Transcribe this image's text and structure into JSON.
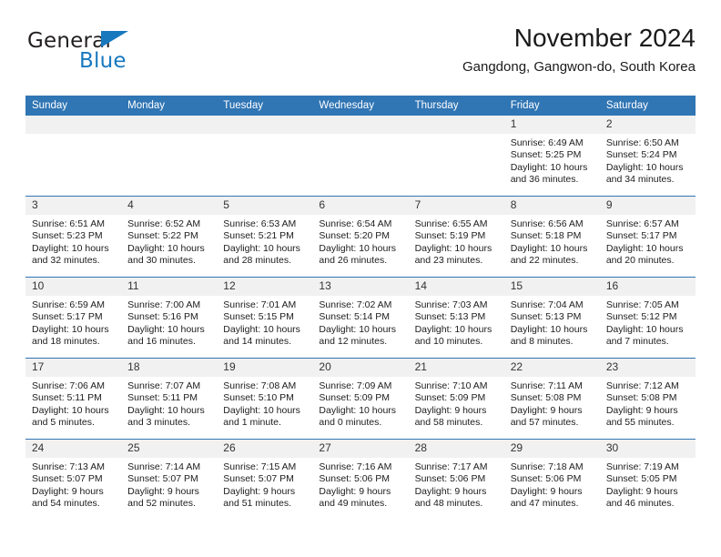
{
  "brand": {
    "name_top": "General",
    "name_bottom": "Blue",
    "triangle_color": "#1878be",
    "text_color": "#231f20"
  },
  "header": {
    "title": "November 2024",
    "subtitle": "Gangdong, Gangwon-do, South Korea"
  },
  "theme": {
    "header_blue": "#3075b4",
    "daynum_bg": "#f1f1f1",
    "text": "#1c1c1c"
  },
  "weekdays": [
    "Sunday",
    "Monday",
    "Tuesday",
    "Wednesday",
    "Thursday",
    "Friday",
    "Saturday"
  ],
  "weeks": [
    [
      {
        "day": "",
        "empty": true
      },
      {
        "day": "",
        "empty": true
      },
      {
        "day": "",
        "empty": true
      },
      {
        "day": "",
        "empty": true
      },
      {
        "day": "",
        "empty": true
      },
      {
        "day": "1",
        "sunrise": "Sunrise: 6:49 AM",
        "sunset": "Sunset: 5:25 PM",
        "daylight": "Daylight: 10 hours and 36 minutes."
      },
      {
        "day": "2",
        "sunrise": "Sunrise: 6:50 AM",
        "sunset": "Sunset: 5:24 PM",
        "daylight": "Daylight: 10 hours and 34 minutes."
      }
    ],
    [
      {
        "day": "3",
        "sunrise": "Sunrise: 6:51 AM",
        "sunset": "Sunset: 5:23 PM",
        "daylight": "Daylight: 10 hours and 32 minutes."
      },
      {
        "day": "4",
        "sunrise": "Sunrise: 6:52 AM",
        "sunset": "Sunset: 5:22 PM",
        "daylight": "Daylight: 10 hours and 30 minutes."
      },
      {
        "day": "5",
        "sunrise": "Sunrise: 6:53 AM",
        "sunset": "Sunset: 5:21 PM",
        "daylight": "Daylight: 10 hours and 28 minutes."
      },
      {
        "day": "6",
        "sunrise": "Sunrise: 6:54 AM",
        "sunset": "Sunset: 5:20 PM",
        "daylight": "Daylight: 10 hours and 26 minutes."
      },
      {
        "day": "7",
        "sunrise": "Sunrise: 6:55 AM",
        "sunset": "Sunset: 5:19 PM",
        "daylight": "Daylight: 10 hours and 23 minutes."
      },
      {
        "day": "8",
        "sunrise": "Sunrise: 6:56 AM",
        "sunset": "Sunset: 5:18 PM",
        "daylight": "Daylight: 10 hours and 22 minutes."
      },
      {
        "day": "9",
        "sunrise": "Sunrise: 6:57 AM",
        "sunset": "Sunset: 5:17 PM",
        "daylight": "Daylight: 10 hours and 20 minutes."
      }
    ],
    [
      {
        "day": "10",
        "sunrise": "Sunrise: 6:59 AM",
        "sunset": "Sunset: 5:17 PM",
        "daylight": "Daylight: 10 hours and 18 minutes."
      },
      {
        "day": "11",
        "sunrise": "Sunrise: 7:00 AM",
        "sunset": "Sunset: 5:16 PM",
        "daylight": "Daylight: 10 hours and 16 minutes."
      },
      {
        "day": "12",
        "sunrise": "Sunrise: 7:01 AM",
        "sunset": "Sunset: 5:15 PM",
        "daylight": "Daylight: 10 hours and 14 minutes."
      },
      {
        "day": "13",
        "sunrise": "Sunrise: 7:02 AM",
        "sunset": "Sunset: 5:14 PM",
        "daylight": "Daylight: 10 hours and 12 minutes."
      },
      {
        "day": "14",
        "sunrise": "Sunrise: 7:03 AM",
        "sunset": "Sunset: 5:13 PM",
        "daylight": "Daylight: 10 hours and 10 minutes."
      },
      {
        "day": "15",
        "sunrise": "Sunrise: 7:04 AM",
        "sunset": "Sunset: 5:13 PM",
        "daylight": "Daylight: 10 hours and 8 minutes."
      },
      {
        "day": "16",
        "sunrise": "Sunrise: 7:05 AM",
        "sunset": "Sunset: 5:12 PM",
        "daylight": "Daylight: 10 hours and 7 minutes."
      }
    ],
    [
      {
        "day": "17",
        "sunrise": "Sunrise: 7:06 AM",
        "sunset": "Sunset: 5:11 PM",
        "daylight": "Daylight: 10 hours and 5 minutes."
      },
      {
        "day": "18",
        "sunrise": "Sunrise: 7:07 AM",
        "sunset": "Sunset: 5:11 PM",
        "daylight": "Daylight: 10 hours and 3 minutes."
      },
      {
        "day": "19",
        "sunrise": "Sunrise: 7:08 AM",
        "sunset": "Sunset: 5:10 PM",
        "daylight": "Daylight: 10 hours and 1 minute."
      },
      {
        "day": "20",
        "sunrise": "Sunrise: 7:09 AM",
        "sunset": "Sunset: 5:09 PM",
        "daylight": "Daylight: 10 hours and 0 minutes."
      },
      {
        "day": "21",
        "sunrise": "Sunrise: 7:10 AM",
        "sunset": "Sunset: 5:09 PM",
        "daylight": "Daylight: 9 hours and 58 minutes."
      },
      {
        "day": "22",
        "sunrise": "Sunrise: 7:11 AM",
        "sunset": "Sunset: 5:08 PM",
        "daylight": "Daylight: 9 hours and 57 minutes."
      },
      {
        "day": "23",
        "sunrise": "Sunrise: 7:12 AM",
        "sunset": "Sunset: 5:08 PM",
        "daylight": "Daylight: 9 hours and 55 minutes."
      }
    ],
    [
      {
        "day": "24",
        "sunrise": "Sunrise: 7:13 AM",
        "sunset": "Sunset: 5:07 PM",
        "daylight": "Daylight: 9 hours and 54 minutes."
      },
      {
        "day": "25",
        "sunrise": "Sunrise: 7:14 AM",
        "sunset": "Sunset: 5:07 PM",
        "daylight": "Daylight: 9 hours and 52 minutes."
      },
      {
        "day": "26",
        "sunrise": "Sunrise: 7:15 AM",
        "sunset": "Sunset: 5:07 PM",
        "daylight": "Daylight: 9 hours and 51 minutes."
      },
      {
        "day": "27",
        "sunrise": "Sunrise: 7:16 AM",
        "sunset": "Sunset: 5:06 PM",
        "daylight": "Daylight: 9 hours and 49 minutes."
      },
      {
        "day": "28",
        "sunrise": "Sunrise: 7:17 AM",
        "sunset": "Sunset: 5:06 PM",
        "daylight": "Daylight: 9 hours and 48 minutes."
      },
      {
        "day": "29",
        "sunrise": "Sunrise: 7:18 AM",
        "sunset": "Sunset: 5:06 PM",
        "daylight": "Daylight: 9 hours and 47 minutes."
      },
      {
        "day": "30",
        "sunrise": "Sunrise: 7:19 AM",
        "sunset": "Sunset: 5:05 PM",
        "daylight": "Daylight: 9 hours and 46 minutes."
      }
    ]
  ]
}
